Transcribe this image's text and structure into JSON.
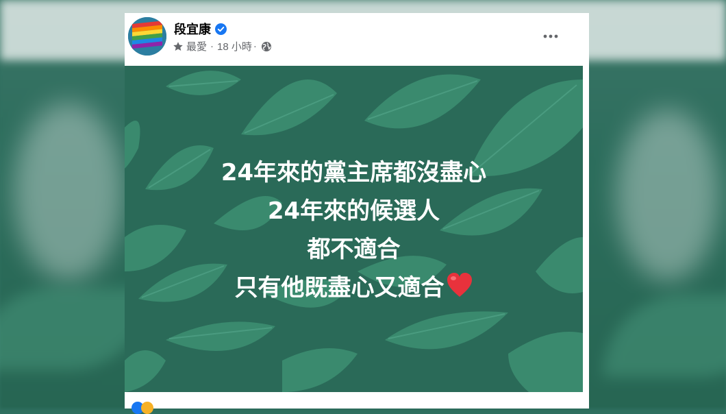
{
  "post": {
    "author": "段宜康",
    "meta": {
      "favorite": "最愛",
      "separator": "·",
      "time": "18 小時"
    },
    "text_lines": [
      "24年來的黨主席都沒盡心",
      "24年來的候選人",
      "都不適合",
      "只有他既盡心又適合"
    ],
    "emoji": "heart"
  },
  "icons": {
    "verified": "verified-badge-icon",
    "favorite": "star-icon",
    "audience": "globe-icon",
    "more": "more-options-icon"
  },
  "colors": {
    "image_background": "#2a6a58",
    "leaf": "#3a8a6e",
    "verified_blue": "#1877f2",
    "meta_gray": "#65676b"
  }
}
